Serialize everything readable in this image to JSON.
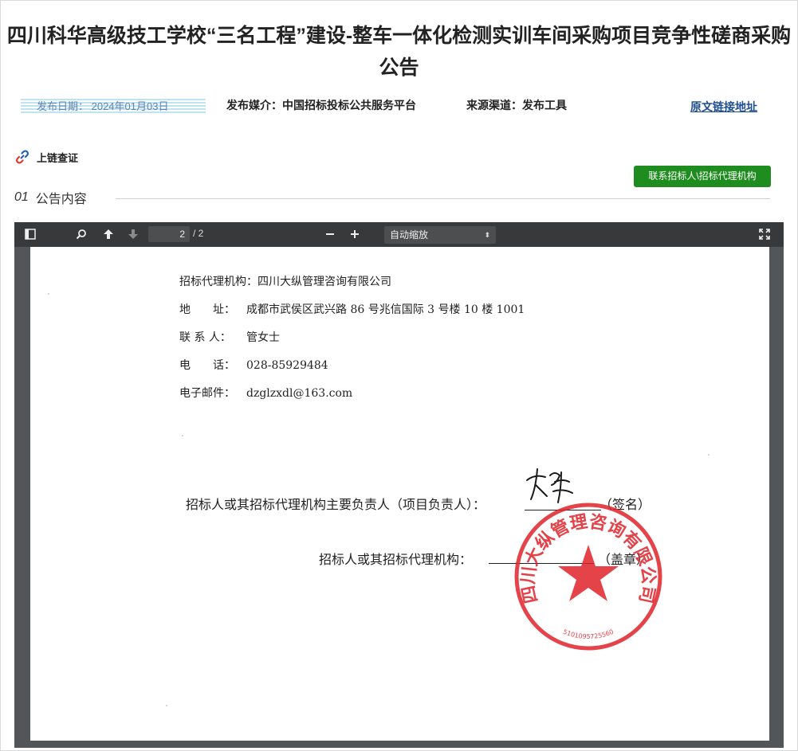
{
  "title": "四川科华高级技工学校“三名工程”建设-整车一体化检测实训车间采购项目竞争性磋商采购公告",
  "meta": {
    "date": "发布日期：  2024年01月03日",
    "media": "发布媒介：中国招标投标公共服务平台",
    "source": "来源渠道：发布工具",
    "original_link": "原文链接地址"
  },
  "chain_label": "上链查证",
  "contact_button": "联系招标人\\招标代理机构",
  "section": {
    "number": "01",
    "label": "公告内容"
  },
  "viewer": {
    "page_current": "2",
    "page_total": "/ 2",
    "zoom": "自动缩放"
  },
  "document": {
    "agency_line": "招标代理机构：四川大纵管理咨询有限公司",
    "fields": [
      {
        "key": "地　　址：",
        "value": "成都市武侯区武兴路 86 号兆信国际 3 号楼 10 楼 1001"
      },
      {
        "key": "联 系 人：",
        "value": "管女士"
      },
      {
        "key": "电　　话：",
        "value": "028-85929484"
      },
      {
        "key": "电子邮件：",
        "value": "dzglzxdl@163.com"
      }
    ],
    "sign_label": "招标人或其招标代理机构主要负责人（项目负责人）：",
    "sign_suffix": "（签名）",
    "seal_label": "招标人或其招标代理机构：",
    "seal_suffix": "（盖章）",
    "stamp_text": "四川大纵管理咨询有限公司",
    "stamp_number": "5101095725560"
  },
  "colors": {
    "green_button": "#1f8c1f",
    "link": "#1e4f8f",
    "stamp_red": "#e0222a",
    "toolbar": "#38393b"
  }
}
